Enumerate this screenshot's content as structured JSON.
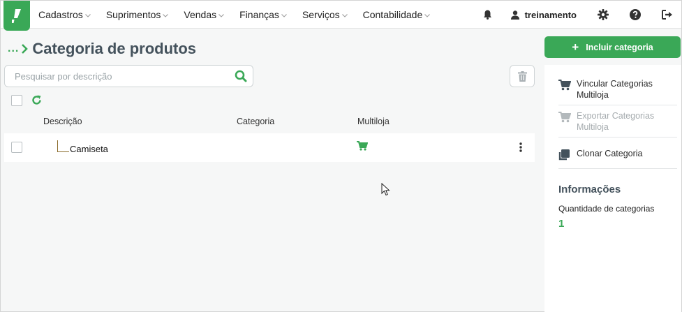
{
  "nav": {
    "items": [
      {
        "label": "Cadastros"
      },
      {
        "label": "Suprimentos"
      },
      {
        "label": "Vendas"
      },
      {
        "label": "Finanças"
      },
      {
        "label": "Serviços"
      },
      {
        "label": "Contabilidade"
      }
    ],
    "user": "treinamento",
    "icons": [
      "bell-icon",
      "user-icon",
      "gear-icon",
      "help-icon",
      "logout-icon"
    ]
  },
  "header": {
    "breadcrumb": "...",
    "title": "Categoria de produtos"
  },
  "search": {
    "placeholder": "Pesquisar por descrição",
    "value": ""
  },
  "table": {
    "columns": [
      "Descrição",
      "Categoria",
      "Multiloja"
    ],
    "rows": [
      {
        "descricao": "Camiseta",
        "categoria": "",
        "multiloja": "cart-icon"
      }
    ]
  },
  "sidebar": {
    "add_button": "Incluir categoria",
    "actions": [
      {
        "label": "Vincular Categorias Multiloja",
        "enabled": true
      },
      {
        "label": "Exportar Categorias Multiloja",
        "enabled": false
      },
      {
        "label": "Clonar Categoria",
        "enabled": true
      }
    ],
    "info": {
      "title": "Informações",
      "label": "Quantidade de categorias",
      "value": "1"
    }
  },
  "colors": {
    "accent": "#3aa857",
    "title": "#44525c",
    "background": "#f6f7f7"
  }
}
